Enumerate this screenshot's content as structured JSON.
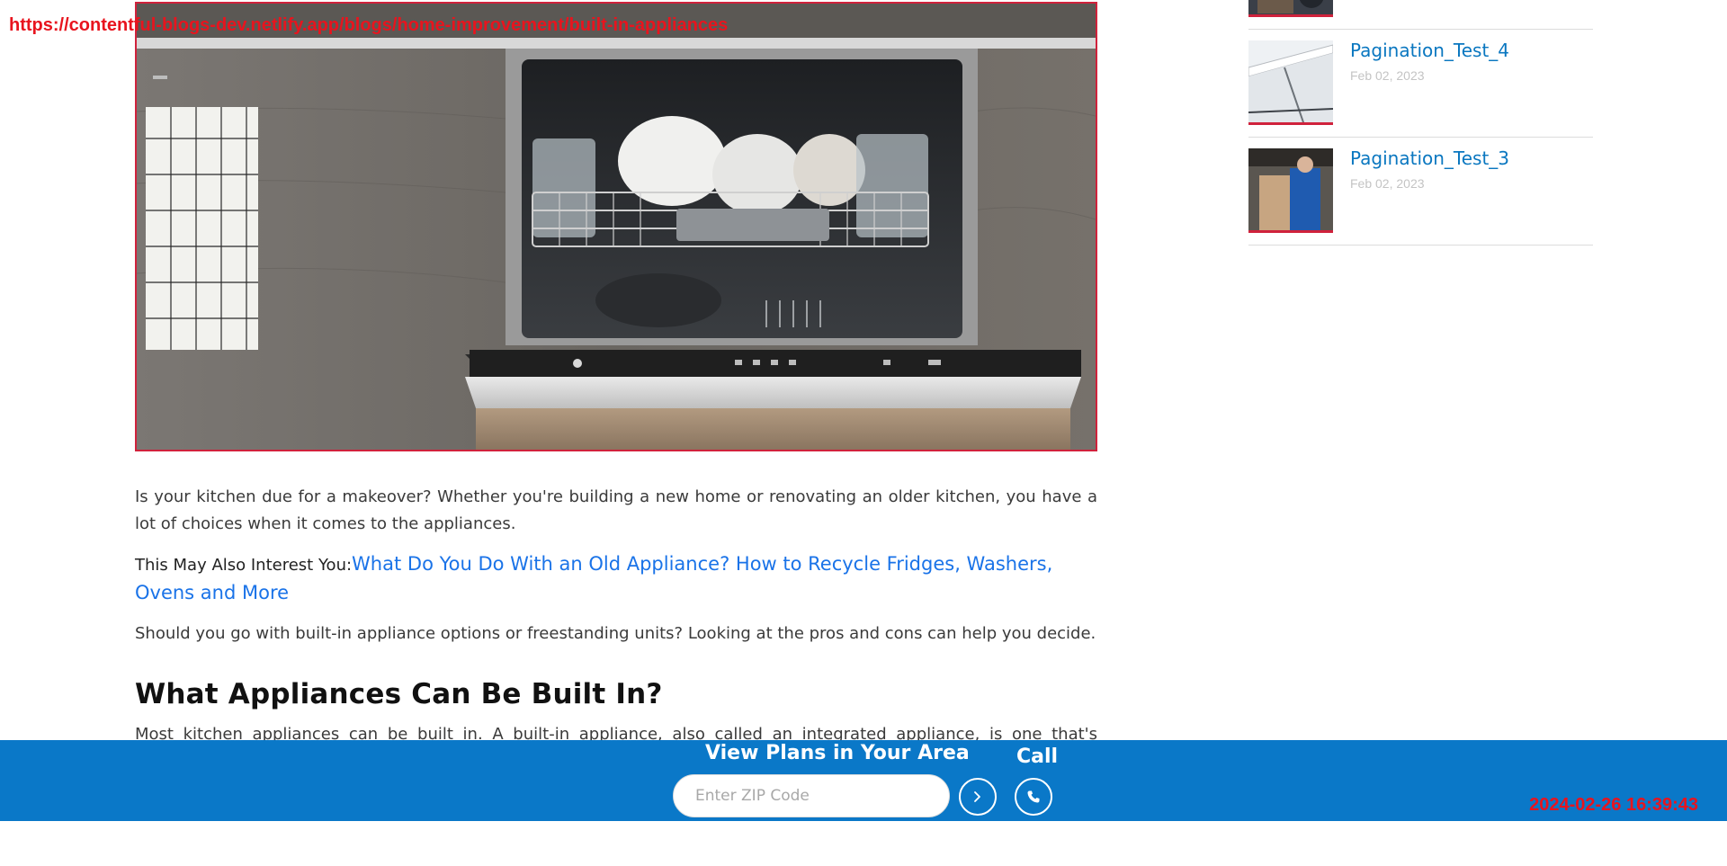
{
  "overlay": {
    "url": "https://contentful-blogs-dev.netlify.app/blogs/home-improvement/built-in-appliances",
    "timestamp": "2024-02-26 16:39:43"
  },
  "article": {
    "intro": "Is your kitchen due for a makeover? Whether you're building a new home or renovating an older kitchen, you have a lot of choices when it comes to the appliances.",
    "interest_label": "This May Also Interest You:",
    "interest_link": "What Do You Do With an Old Appliance? How to Recycle Fridges, Washers, Ovens and More",
    "pros_cons": "Should you go with built-in appliance options or freestanding units? Looking at the pros and cons can help you decide.",
    "heading": "What Appliances Can Be Built In?",
    "body": "Most kitchen appliances can be built in. A built-in appliance, also called an integrated appliance, is one that's integrated"
  },
  "sidebar": {
    "items": [
      {
        "title": "Pagination_Test_4",
        "date": "Feb 02, 2023"
      },
      {
        "title": "Pagination_Test_3",
        "date": "Feb 02, 2023"
      }
    ]
  },
  "cta": {
    "title": "View Plans in Your Area",
    "zip_placeholder": "Enter ZIP Code",
    "call_label": "Call"
  },
  "colors": {
    "accent_blue": "#0a78c8",
    "link_blue": "#1a73e8",
    "accent_red": "#d0223c"
  }
}
